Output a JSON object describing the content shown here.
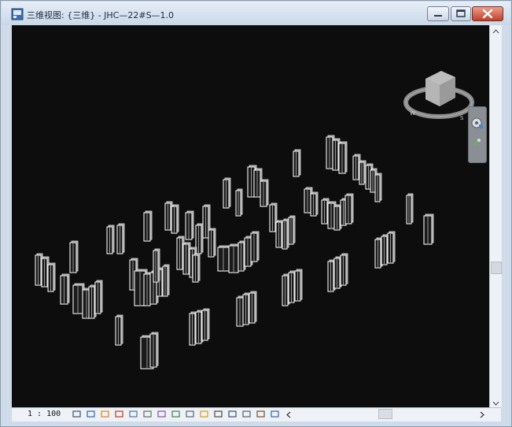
{
  "window": {
    "title": "三维视图: {三维} - JHC—22#S—1.0"
  },
  "statusbar": {
    "scale": "1 : 100"
  },
  "colors": {
    "canvas": "#0d0d0d",
    "column_face": "#f2f2f2",
    "column_shade": "#8c8c8c",
    "titlebar": "#d6e2ef",
    "close_button": "#c9442e"
  },
  "icons": [
    "app-icon",
    "minimize-icon",
    "maximize-icon",
    "close-icon",
    "viewcube-icon",
    "steering-wheel-icon",
    "zoom-icon",
    "detail-level-icon",
    "visual-style-icon",
    "sun-path-icon",
    "shadows-icon",
    "rendering-icon",
    "crop-region-icon",
    "show-crop-icon",
    "unlock-view-icon",
    "temporary-hide-icon",
    "reveal-hidden-icon",
    "lock-3d-icon",
    "worksharing-icon",
    "design-options-icon",
    "analytical-model-icon",
    "highlight-displacement-icon"
  ]
}
